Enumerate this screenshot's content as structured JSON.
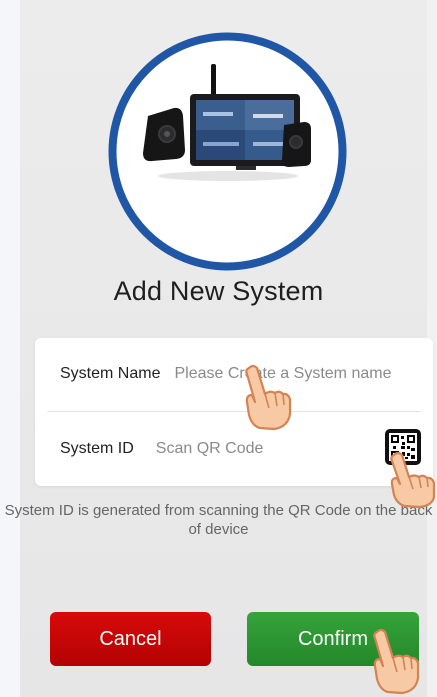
{
  "title": "Add New System",
  "form": {
    "system_name": {
      "label": "System Name",
      "placeholder": "Please Create a System name",
      "value": ""
    },
    "system_id": {
      "label": "System ID",
      "placeholder": "Scan QR Code",
      "value": ""
    },
    "qr_icon": "qr-code-icon"
  },
  "hint": "System ID is generated from scanning the QR Code on the back of device",
  "buttons": {
    "cancel_label": "Cancel",
    "confirm_label": "Confirm"
  },
  "colors": {
    "cancel": "#c80606",
    "confirm": "#2f9a34",
    "ring": "#1f57a6"
  }
}
